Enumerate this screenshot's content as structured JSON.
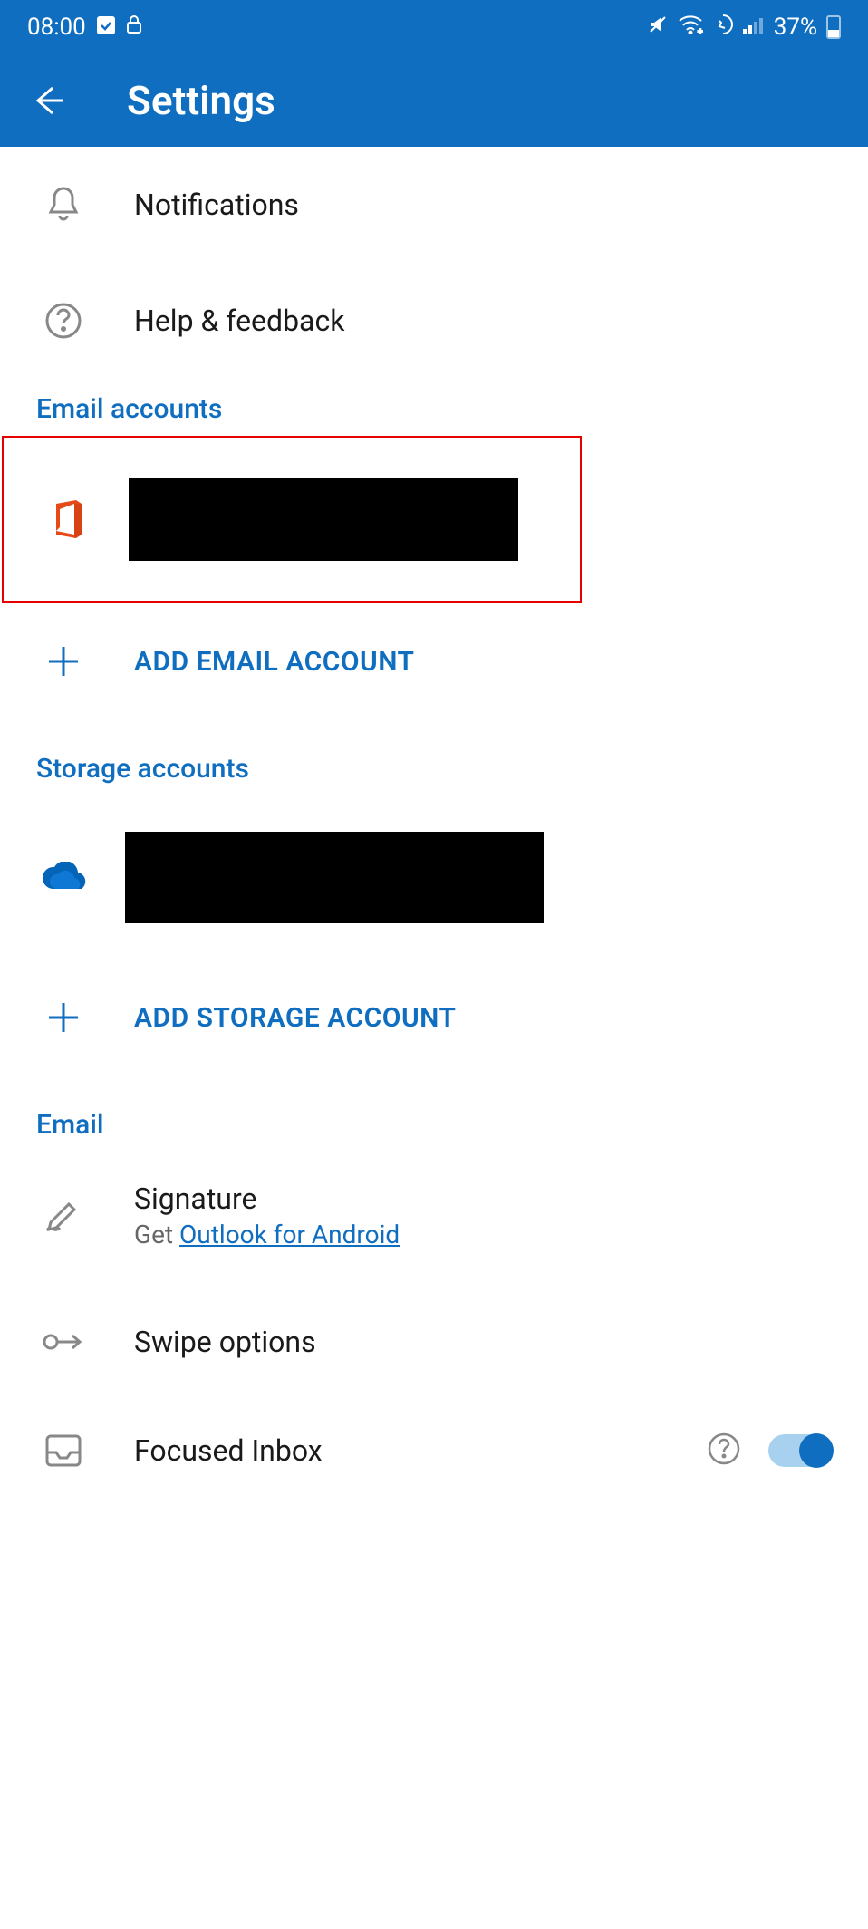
{
  "status_bar": {
    "time": "08:00",
    "battery": "37%"
  },
  "app_bar": {
    "title": "Settings"
  },
  "items": {
    "notifications": "Notifications",
    "help_feedback": "Help & feedback",
    "signature": "Signature",
    "signature_sub_prefix": "Get ",
    "signature_link": "Outlook for Android",
    "swipe_options": "Swipe options",
    "focused_inbox": "Focused Inbox"
  },
  "sections": {
    "email_accounts": "Email accounts",
    "storage_accounts": "Storage accounts",
    "email": "Email"
  },
  "actions": {
    "add_email": "ADD EMAIL ACCOUNT",
    "add_storage": "ADD STORAGE ACCOUNT"
  }
}
